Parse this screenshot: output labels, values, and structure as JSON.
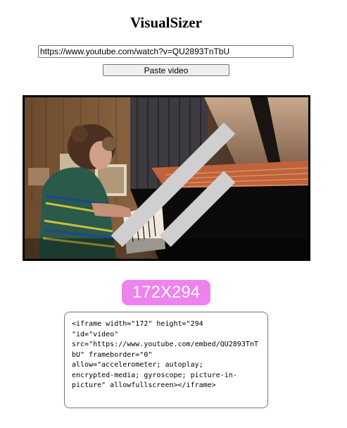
{
  "header": {
    "title": "VisualSizer"
  },
  "url_input": {
    "value": "https://www.youtube.com/watch?v=QU2893TnTbU"
  },
  "paste_button": {
    "label": "Paste video"
  },
  "video": {
    "description_icon": "piano-performance-video"
  },
  "size_badge": {
    "text": "172X294",
    "color": "#ee82ee"
  },
  "embed_code": {
    "text": "<iframe width=\"172\" height=\"294\n\"id=\"video\"\nsrc=\"https://www.youtube.com/embed/QU2893TnTbU\" frameborder=\"0\"\nallow=\"accelerometer; autoplay;\nencrypted-media; gyroscope; picture-in-\npicture\" allowfullscreen></iframe>"
  }
}
